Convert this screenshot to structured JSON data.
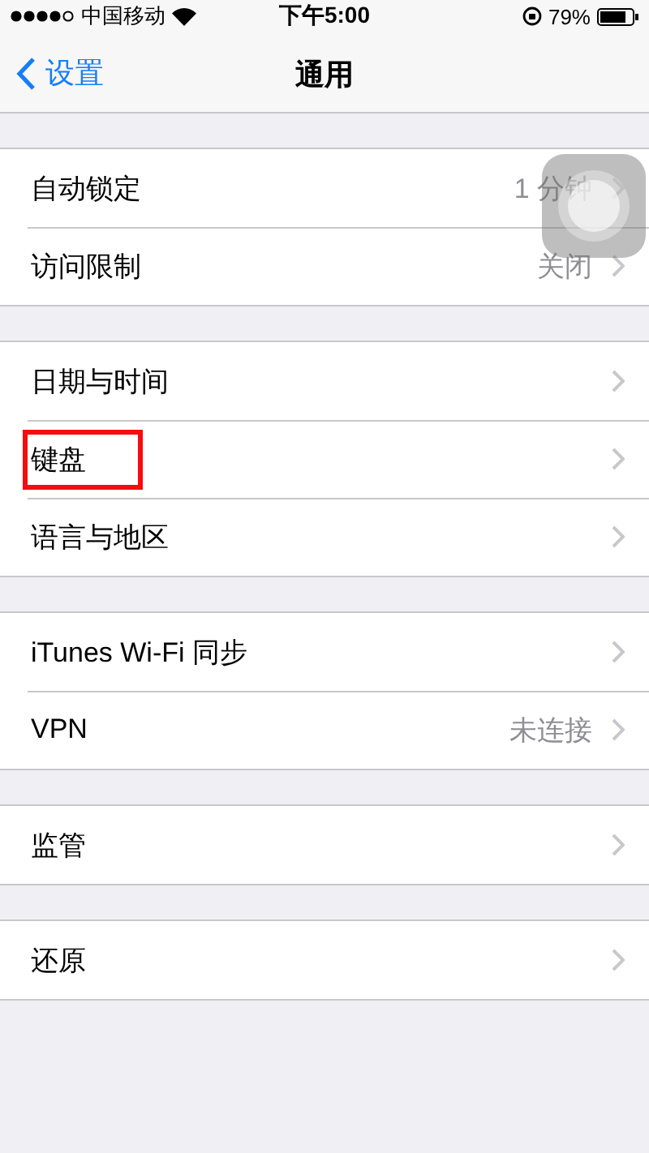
{
  "status_bar": {
    "carrier": "中国移动",
    "time": "下午5:00",
    "battery": "79%"
  },
  "nav_bar": {
    "back": "设置",
    "title": "通用"
  },
  "groups": [
    {
      "rows": [
        {
          "label": "自动锁定",
          "value": "1 分钟",
          "highlighted": false
        },
        {
          "label": "访问限制",
          "value": "关闭",
          "highlighted": false
        }
      ]
    },
    {
      "rows": [
        {
          "label": "日期与时间",
          "highlighted": false
        },
        {
          "label": "键盘",
          "highlighted": true
        },
        {
          "label": "语言与地区",
          "highlighted": false
        }
      ]
    },
    {
      "rows": [
        {
          "label": "iTunes Wi-Fi 同步",
          "highlighted": false
        },
        {
          "label": "VPN",
          "value": "未连接",
          "highlighted": false
        }
      ]
    },
    {
      "rows": [
        {
          "label": "监管",
          "highlighted": false
        }
      ]
    },
    {
      "rows": [
        {
          "label": "还原",
          "highlighted": false
        }
      ]
    }
  ]
}
